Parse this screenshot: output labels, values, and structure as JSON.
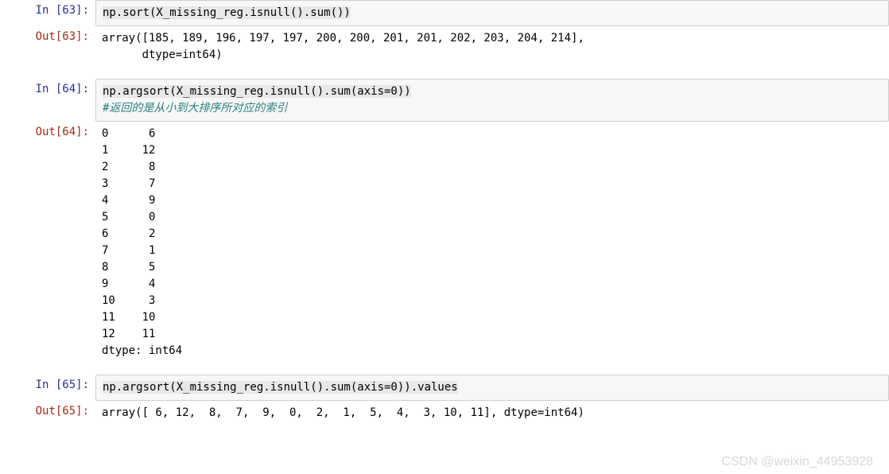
{
  "cell63": {
    "in_label": "In  [63]:",
    "code_hl": "np.sort(X_missing_reg.isnull().sum())",
    "out_label": "Out[63]:",
    "out_text": "array([185, 189, 196, 197, 197, 200, 200, 201, 201, 202, 203, 204, 214],\n      dtype=int64)"
  },
  "cell64": {
    "in_label": "In  [64]:",
    "code_hl": "np.argsort(X_missing_reg.isnull().sum(axis=0))",
    "comment": "#返回的是从小到大排序所对应的索引",
    "out_label": "Out[64]:",
    "out_text": "0      6\n1     12\n2      8\n3      7\n4      9\n5      0\n6      2\n7      1\n8      5\n9      4\n10     3\n11    10\n12    11\ndtype: int64"
  },
  "cell65": {
    "in_label": "In  [65]:",
    "code_hl": "np.argsort(X_missing_reg.isnull().sum(axis=0)).values",
    "out_label": "Out[65]:",
    "out_text": "array([ 6, 12,  8,  7,  9,  0,  2,  1,  5,  4,  3, 10, 11], dtype=int64)"
  },
  "watermark": "CSDN @weixin_44953928"
}
